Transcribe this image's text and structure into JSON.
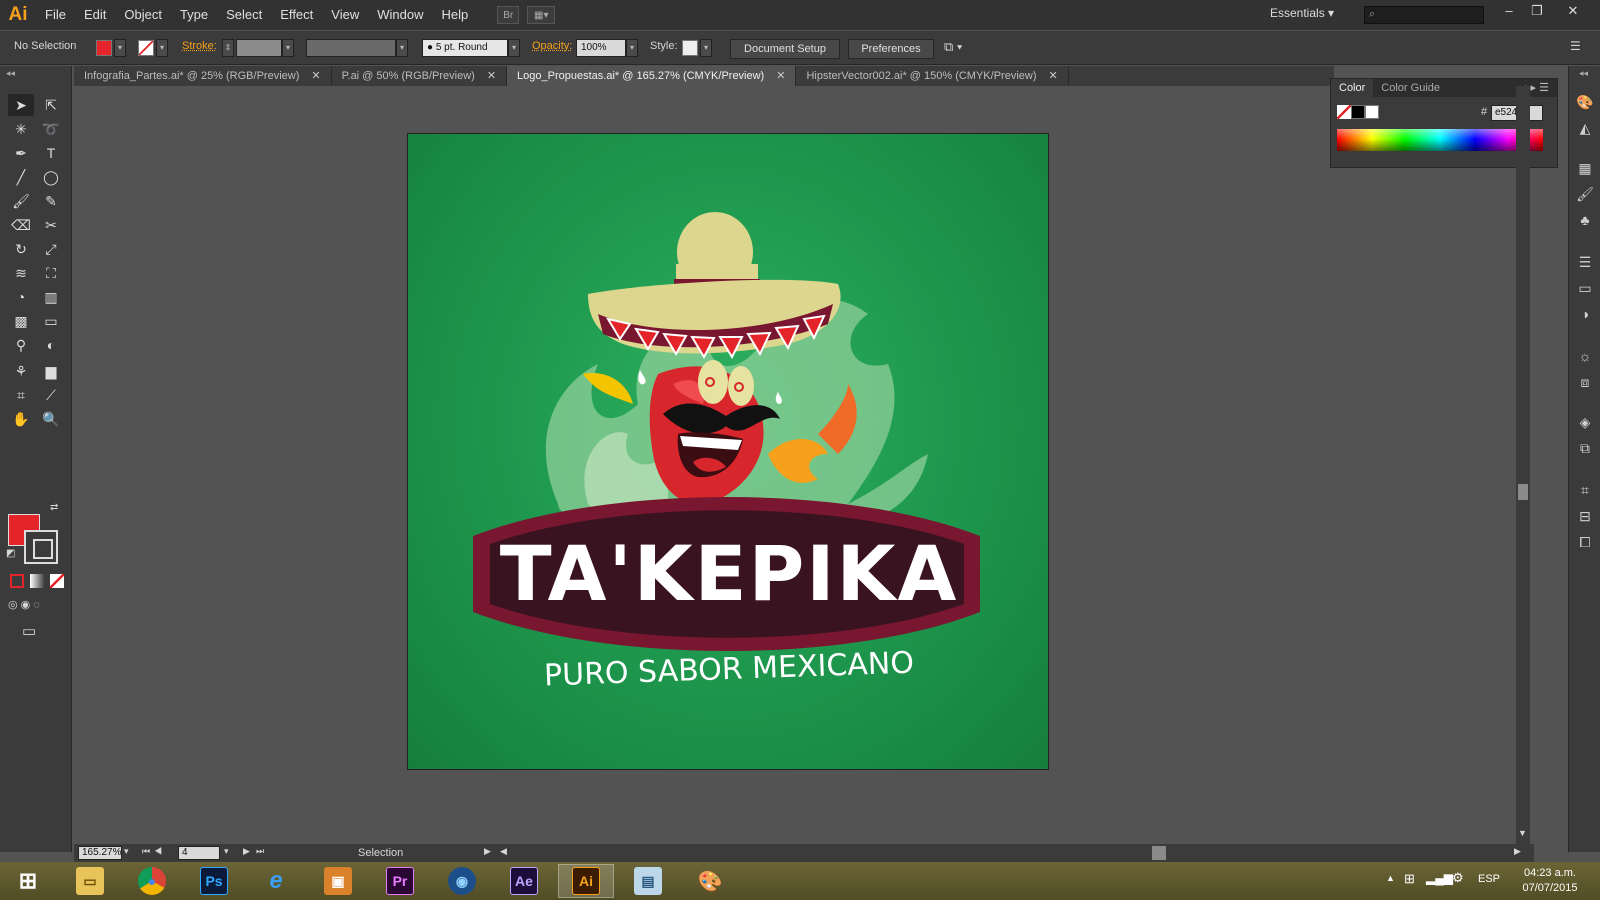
{
  "app": {
    "logo": "Ai"
  },
  "menu": [
    "File",
    "Edit",
    "Object",
    "Type",
    "Select",
    "Effect",
    "View",
    "Window",
    "Help"
  ],
  "menubar_extras": {
    "bridge": "Br",
    "workspace": "Essentials"
  },
  "window_buttons": [
    "minimize",
    "restore",
    "close"
  ],
  "control_bar": {
    "selection": "No Selection",
    "stroke_label": "Stroke:",
    "brush": "5 pt. Round",
    "opacity_label": "Opacity:",
    "opacity_value": "100%",
    "style_label": "Style:",
    "document_setup": "Document Setup",
    "preferences": "Preferences"
  },
  "tabs": [
    {
      "label": "Infografia_Partes.ai* @ 25% (RGB/Preview)",
      "active": false
    },
    {
      "label": "P.ai @ 50% (RGB/Preview)",
      "active": false
    },
    {
      "label": "Logo_Propuestas.ai* @ 165.27% (CMYK/Preview)",
      "active": true
    },
    {
      "label": "HipsterVector002.ai* @ 150% (CMYK/Preview)",
      "active": false
    }
  ],
  "artwork": {
    "brand_name": "TA'KEPIKA",
    "tagline": "PURO SABOR MEXICANO"
  },
  "color_panel": {
    "tabs": [
      "Color",
      "Color Guide"
    ],
    "hex_label": "#",
    "hex_value": "e52429"
  },
  "status_bar": {
    "zoom": "165.27%",
    "artboard_number": "4",
    "tool_name": "Selection"
  },
  "taskbar": {
    "apps": [
      "Windows Start",
      "File Explorer",
      "Chrome",
      "Photoshop",
      "Internet Explorer",
      "Photo Viewer",
      "Premiere",
      "Media Player",
      "After Effects",
      "Illustrator",
      "Notepad",
      "Paint"
    ],
    "language": "ESP",
    "time": "04:23 a.m.",
    "date": "07/07/2015"
  },
  "colors": {
    "accent": "#f7a01c",
    "fill": "#e52429",
    "artboard_green": "#1f9a4f",
    "banner": "#3a1320"
  }
}
